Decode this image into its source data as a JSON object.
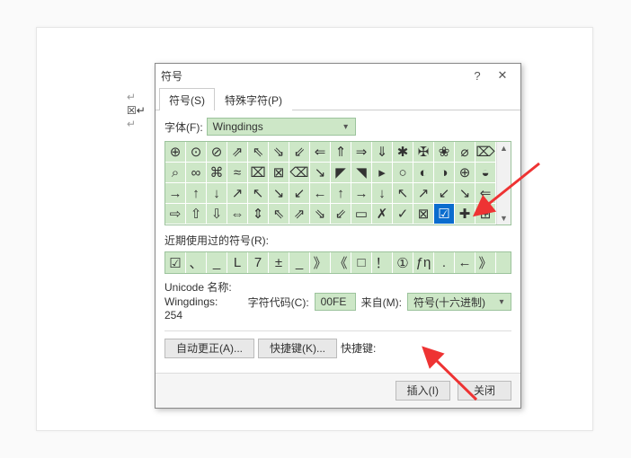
{
  "dialog": {
    "title": "符号",
    "help_icon": "?",
    "close_icon": "✕"
  },
  "tabs": {
    "symbols": "符号(S)",
    "special": "特殊字符(P)"
  },
  "font": {
    "label": "字体(F):",
    "value": "Wingdings"
  },
  "grid": [
    [
      "⊕",
      "⊙",
      "⊘",
      "⇗",
      "⇖",
      "⇘",
      "⇙",
      "⇐",
      "⇑",
      "⇒",
      "⇓",
      "✱",
      "✠",
      "❀",
      "⌀",
      "⌦"
    ],
    [
      "⌕",
      "∞",
      "⌘",
      "≈",
      "⌧",
      "⊠",
      "⌫",
      "↘",
      "◤",
      "◥",
      "▸",
      "○",
      "◐",
      "◑",
      "⊕",
      "◒"
    ],
    [
      "→",
      "↑",
      "↓",
      "↗",
      "↖",
      "↘",
      "↙",
      "←",
      "↑",
      "→",
      "↓",
      "↖",
      "↗",
      "↙",
      "↘",
      "⇐"
    ],
    [
      "⇨",
      "⇧",
      "⇩",
      "⇔",
      "⇕",
      "⇖",
      "⇗",
      "⇘",
      "⇙",
      "▭",
      "✗",
      "✓",
      "⊠",
      "☑",
      "✚",
      "⊞"
    ]
  ],
  "grid_selected": {
    "row": 3,
    "col": 13
  },
  "recent": {
    "label": "近期使用过的符号(R):",
    "items": [
      "☑",
      "、",
      "_",
      "L",
      "7",
      "±",
      "_",
      "》",
      "《",
      "□",
      "！",
      "①",
      "ƒη",
      ".",
      "←",
      "》"
    ]
  },
  "info": {
    "unicode_name_label": "Unicode 名称:",
    "unicode_name_value": "Wingdings: 254",
    "code_label": "字符代码(C):",
    "code_value": "00FE",
    "from_label": "来自(M):",
    "from_value": "符号(十六进制)"
  },
  "buttons": {
    "autocorrect": "自动更正(A)...",
    "shortcut": "快捷键(K)...",
    "shortcut_label": "快捷键:",
    "insert": "插入(I)",
    "close": "关闭"
  },
  "doc_marks": {
    "para1": "↵",
    "check": "☒↵",
    "para2": "↵"
  }
}
